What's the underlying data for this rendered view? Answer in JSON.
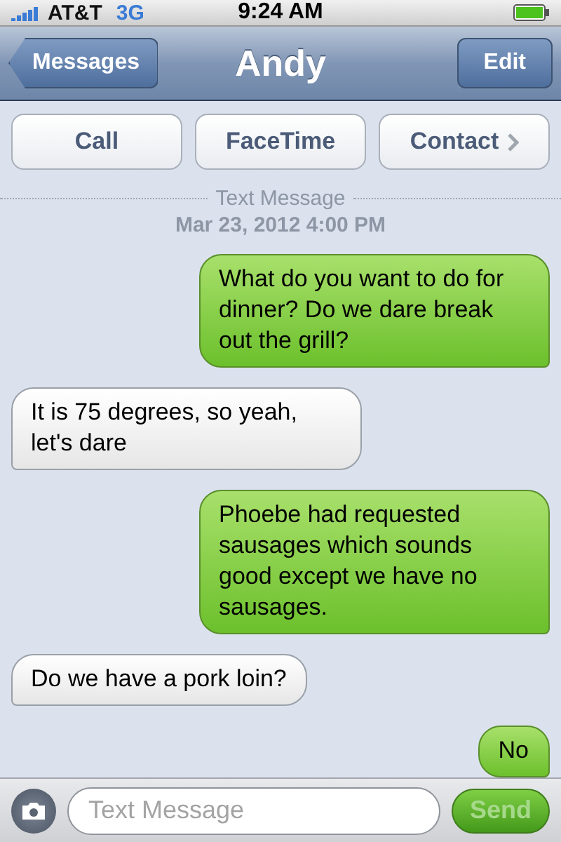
{
  "status_bar": {
    "carrier": "AT&T",
    "network": "3G",
    "time": "9:24 AM"
  },
  "nav_bar": {
    "back": "Messages",
    "title": "Andy",
    "edit": "Edit"
  },
  "actions": [
    {
      "label": "Call",
      "kind": "plain"
    },
    {
      "label": "FaceTime",
      "kind": "plain"
    },
    {
      "label": "Contact",
      "kind": "chevron"
    }
  ],
  "header": {
    "service": "Text Message",
    "date": "Mar 23, 2012 4:00 PM"
  },
  "messages": [
    {
      "text": "What do you want to do for dinner? Do we dare break out the grill?",
      "kind": "sent"
    },
    {
      "text": "It is 75 degrees, so yeah, let's dare",
      "kind": "received"
    },
    {
      "text": "Phoebe had requested sausages which sounds good except we have no sausages.",
      "kind": "sent"
    },
    {
      "text": "Do we have a pork loin?",
      "kind": "received"
    },
    {
      "text": "No",
      "kind": "sent"
    }
  ],
  "composer": {
    "placeholder": "Text Message",
    "send": "Send",
    "send_disabled": true
  }
}
